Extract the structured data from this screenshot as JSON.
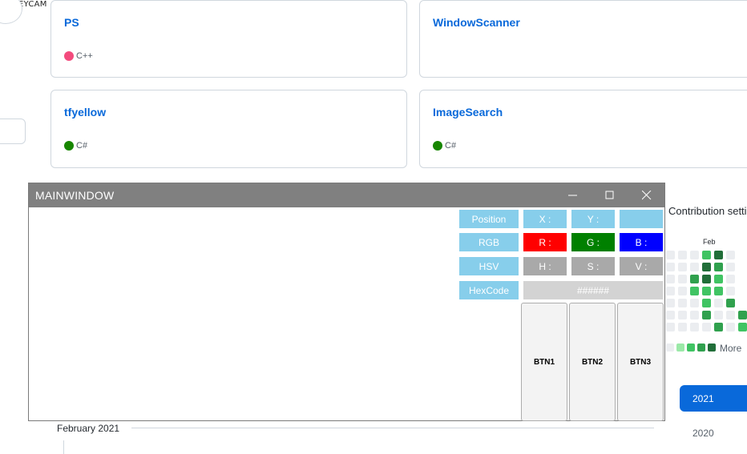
{
  "watermark": "HOKEYCAM",
  "repos": [
    {
      "name": "PS",
      "lang": "C++",
      "lang_color": "#f34b7d"
    },
    {
      "name": "WindowScanner",
      "lang": "",
      "lang_color": ""
    },
    {
      "name": "tfyellow",
      "lang": "C#",
      "lang_color": "#178600"
    },
    {
      "name": "ImageSearch",
      "lang": "C#",
      "lang_color": "#178600"
    }
  ],
  "contributions": {
    "settings_link": "Contribution settings",
    "month": "Feb",
    "more_label": "More",
    "levels": [
      [
        0,
        0,
        0,
        2,
        4,
        0
      ],
      [
        0,
        0,
        0,
        4,
        3,
        0
      ],
      [
        0,
        0,
        3,
        4,
        2,
        0
      ],
      [
        0,
        0,
        2,
        2,
        2,
        0
      ],
      [
        0,
        0,
        0,
        2,
        0,
        3
      ],
      [
        0,
        0,
        0,
        3,
        0,
        0,
        3
      ],
      [
        0,
        0,
        0,
        0,
        3,
        0,
        2
      ]
    ],
    "legend_levels": [
      0,
      1,
      2,
      3,
      4
    ],
    "colors": [
      "#ebedf0",
      "#9be9a8",
      "#40c463",
      "#30a14e",
      "#216e39"
    ]
  },
  "years": [
    "2021",
    "2020"
  ],
  "timeline_month": "February 2021",
  "window": {
    "title": "MAINWINDOW",
    "controls": {
      "minimize": "minimize-icon",
      "maximize": "maximize-icon",
      "close": "close-icon"
    },
    "rows": [
      {
        "label": "Position",
        "fields": [
          "X :",
          "Y :",
          ""
        ],
        "colors": [
          "#87ceeb",
          "#87ceeb",
          "#87ceeb"
        ]
      },
      {
        "label": "RGB",
        "fields": [
          "R :",
          "G :",
          "B :"
        ],
        "colors": [
          "#ff0000",
          "#008000",
          "#0000ff"
        ]
      },
      {
        "label": "HSV",
        "fields": [
          "H :",
          "S :",
          "V :"
        ],
        "colors": [
          "#a9a9a9",
          "#a9a9a9",
          "#a9a9a9"
        ]
      }
    ],
    "hex_label": "HexCode",
    "hex_value": "######",
    "buttons": [
      "BTN1",
      "BTN2",
      "BTN3"
    ]
  }
}
